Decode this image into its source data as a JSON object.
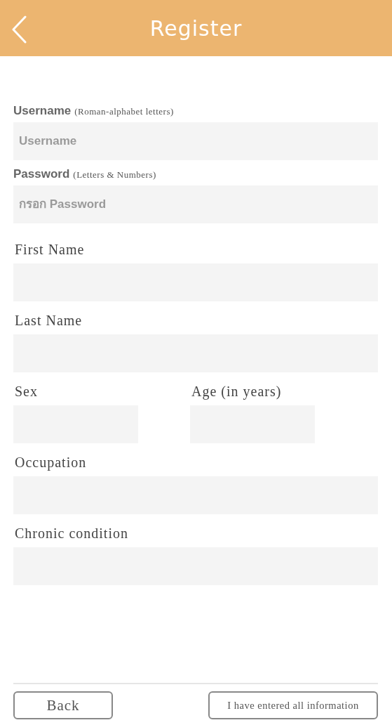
{
  "header": {
    "title": "Register"
  },
  "form": [
    {
      "kind": "account",
      "label": "Username",
      "note": "(Roman-alphabet letters)",
      "placeholder": "Username"
    },
    {
      "kind": "account",
      "label": "Password",
      "note": "(Letters & Numbers)",
      "placeholder": "กรอก Password"
    },
    {
      "kind": "profile",
      "label": "First Name"
    },
    {
      "kind": "profile",
      "label": "Last Name"
    },
    {
      "kind": "pair",
      "fields": [
        {
          "label": "Sex"
        },
        {
          "label": "Age (in years)"
        }
      ]
    },
    {
      "kind": "profile",
      "label": "Occupation"
    },
    {
      "kind": "profile",
      "label": "Chronic condition"
    }
  ],
  "buttons": {
    "back": "Back",
    "submit": "I have entered all information"
  }
}
